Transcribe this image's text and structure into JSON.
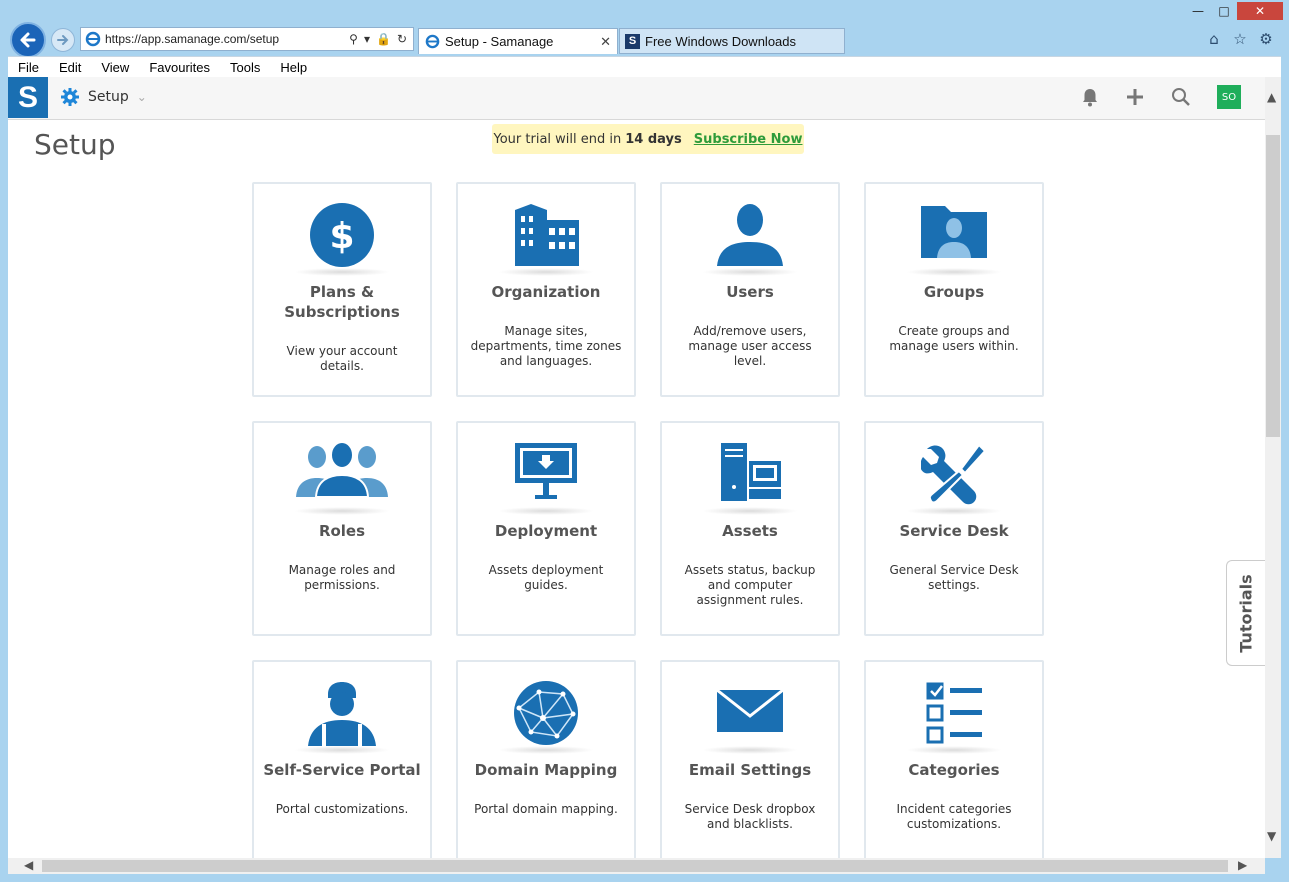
{
  "browser": {
    "url": "https://app.samanage.com/setup",
    "tabs": [
      {
        "label": "Setup - Samanage",
        "active": true
      },
      {
        "label": "Free Windows Downloads",
        "active": false
      }
    ],
    "menu": [
      "File",
      "Edit",
      "View",
      "Favourites",
      "Tools",
      "Help"
    ]
  },
  "app": {
    "logo": "S",
    "breadcrumb": "Setup",
    "avatar": "SO",
    "accent": "#1a6fb2",
    "page_title": "Setup",
    "trial": {
      "text": "Your trial will end in",
      "days": "14 days",
      "link": "Subscribe Now"
    },
    "tutorials": "Tutorials"
  },
  "cards": [
    {
      "title": "Plans & Subscriptions",
      "desc": "View your account details.",
      "icon": "dollar-icon"
    },
    {
      "title": "Organization",
      "desc": "Manage sites, departments, time zones and languages.",
      "icon": "building-icon"
    },
    {
      "title": "Users",
      "desc": "Add/remove users, manage user access level.",
      "icon": "user-icon"
    },
    {
      "title": "Groups",
      "desc": "Create groups and manage users within.",
      "icon": "folder-user-icon"
    },
    {
      "title": "Roles",
      "desc": "Manage roles and permissions.",
      "icon": "roles-icon"
    },
    {
      "title": "Deployment",
      "desc": "Assets deployment guides.",
      "icon": "monitor-download-icon"
    },
    {
      "title": "Assets",
      "desc": "Assets status, backup and computer assignment rules.",
      "icon": "computer-icon"
    },
    {
      "title": "Service Desk",
      "desc": "General Service Desk settings.",
      "icon": "tools-icon"
    },
    {
      "title": "Self-Service Portal",
      "desc": "Portal customizations.",
      "icon": "worker-icon"
    },
    {
      "title": "Domain Mapping",
      "desc": "Portal domain mapping.",
      "icon": "globe-icon"
    },
    {
      "title": "Email Settings",
      "desc": "Service Desk dropbox and blacklists.",
      "icon": "envelope-icon"
    },
    {
      "title": "Categories",
      "desc": "Incident categories customizations.",
      "icon": "checklist-icon"
    }
  ]
}
